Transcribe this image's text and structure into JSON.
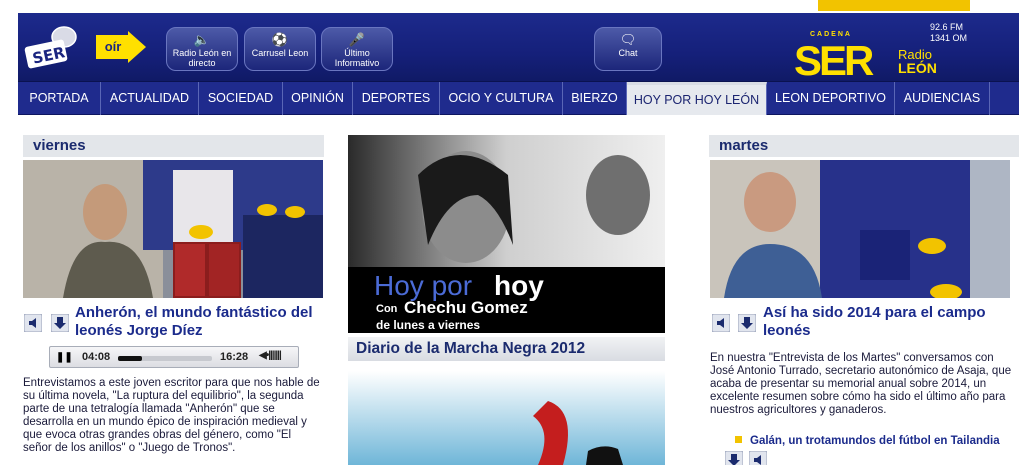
{
  "header": {
    "oir_label": "oír",
    "buttons": [
      {
        "label": "Radio León en directo",
        "icon": "speaker-icon"
      },
      {
        "label": "Carrusel Leon",
        "icon": "soccer-ball-icon"
      },
      {
        "label": "Último Informativo",
        "icon": "microphone-icon"
      },
      {
        "label": "Chat",
        "icon": "chat-bubble-icon"
      }
    ],
    "freq_fm": "92.6 FM",
    "freq_om": "1341 OM",
    "brand_top": "CADENA",
    "brand": "SER",
    "brand_radio": "Radio",
    "brand_city": "LEÓN"
  },
  "nav": {
    "tabs": [
      "PORTADA",
      "ACTUALIDAD",
      "SOCIEDAD",
      "OPINIÓN",
      "DEPORTES",
      "OCIO Y CULTURA",
      "BIERZO",
      "HOY POR HOY LEÓN",
      "LEON DEPORTIVO",
      "AUDIENCIAS"
    ],
    "active": "HOY POR HOY LEÓN"
  },
  "left": {
    "day": "viernes",
    "title": "Anherón, el mundo fantástico del leonés Jorge Díez",
    "player": {
      "current": "04:08",
      "total": "16:28",
      "progress": 0.25
    },
    "body": "Entrevistamos a este joven escritor para que nos hable de su última novela, \"La ruptura del equilibrio\", la segunda parte de una tetralogía llamada \"Anherón\" que se desarrolla en un mundo épico de inspiración medieval y que evoca otras grandes obras del género, como \"El señor de los anillos\" o \"Juego de Tronos\"."
  },
  "middle": {
    "banner_hoy": "Hoy por",
    "banner_hoy2": "hoy",
    "banner_con": "Con",
    "banner_name": "Chechu Gomez",
    "banner_days": "de lunes a viernes",
    "subtitle": "Diario de la Marcha Negra 2012"
  },
  "right": {
    "day": "martes",
    "title": "Así ha sido 2014 para el campo leonés",
    "body": "En nuestra \"Entrevista de los Martes\" conversamos con José Antonio Turrado, secretario autonómico de Asaja, que acaba de presentar su memorial anual sobre 2014, un excelente resumen sobre cómo ha sido el último año para nuestros agricultores y ganaderos.",
    "related": "Galán, un trotamundos del fútbol en Tailandia"
  },
  "colors": {
    "header_blue": "#1f2b8d",
    "brand_yellow": "#ffe000",
    "title_blue": "#1b2b8c"
  }
}
